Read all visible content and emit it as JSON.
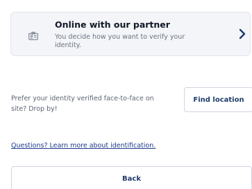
{
  "partner_option": {
    "title": "Online with our partner",
    "description": "You decide how you want to verify your identity.",
    "icon": "id-card-icon",
    "action_icon": "chevron-right-icon"
  },
  "face_to_face": {
    "text": "Prefer your identity verified face-to-face on site? Drop by!",
    "button_label": "Find location"
  },
  "learn_more": {
    "link_text": "Questions? Learn more about identification."
  },
  "footer": {
    "back_label": "Back"
  },
  "colors": {
    "card_bg": "#f3f5f8",
    "accent": "#1d3a6b",
    "link": "#1e3a8a"
  }
}
